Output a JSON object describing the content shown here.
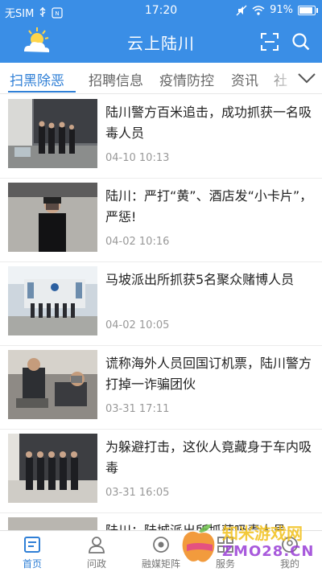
{
  "status_bar": {
    "carrier": "无SIM",
    "time": "17:20",
    "battery": "91%",
    "battery_level": 0.91
  },
  "header": {
    "title": "云上陆川"
  },
  "tabs": [
    {
      "label": "扫黑除恶",
      "active": true
    },
    {
      "label": "招聘信息"
    },
    {
      "label": "疫情防控"
    },
    {
      "label": "资讯"
    },
    {
      "label": "社"
    }
  ],
  "news": [
    {
      "title": "陆川警方百米追击，成功抓获一名吸毒人员",
      "time": "04-10 10:13"
    },
    {
      "title": "陆川：严打“黄”、酒店发“小卡片”，严惩!",
      "time": "04-02 10:16"
    },
    {
      "title": "马坡派出所抓获5名聚众赌博人员",
      "time": "04-02 10:05"
    },
    {
      "title": "谎称海外人员回国订机票，陆川警方打掉一诈骗团伙",
      "time": "03-31 17:11"
    },
    {
      "title": "为躲避打击，这伙人竟藏身于车内吸毒",
      "time": "03-31 16:05"
    },
    {
      "title": "陆川：陆城派出所抓获吸毒人员",
      "time": ""
    }
  ],
  "bottom_nav": [
    {
      "label": "首页",
      "icon": "home-icon",
      "active": true
    },
    {
      "label": "问政",
      "icon": "user-icon"
    },
    {
      "label": "融媒矩阵",
      "icon": "media-icon"
    },
    {
      "label": "服务",
      "icon": "grid-icon"
    },
    {
      "label": "我的",
      "icon": "profile-icon"
    }
  ],
  "watermark": {
    "line1": "知米游戏网",
    "line2": "ZMO28.CN"
  },
  "colors": {
    "header": "#3a8ee6",
    "active_tab": "#2f7fd6"
  }
}
